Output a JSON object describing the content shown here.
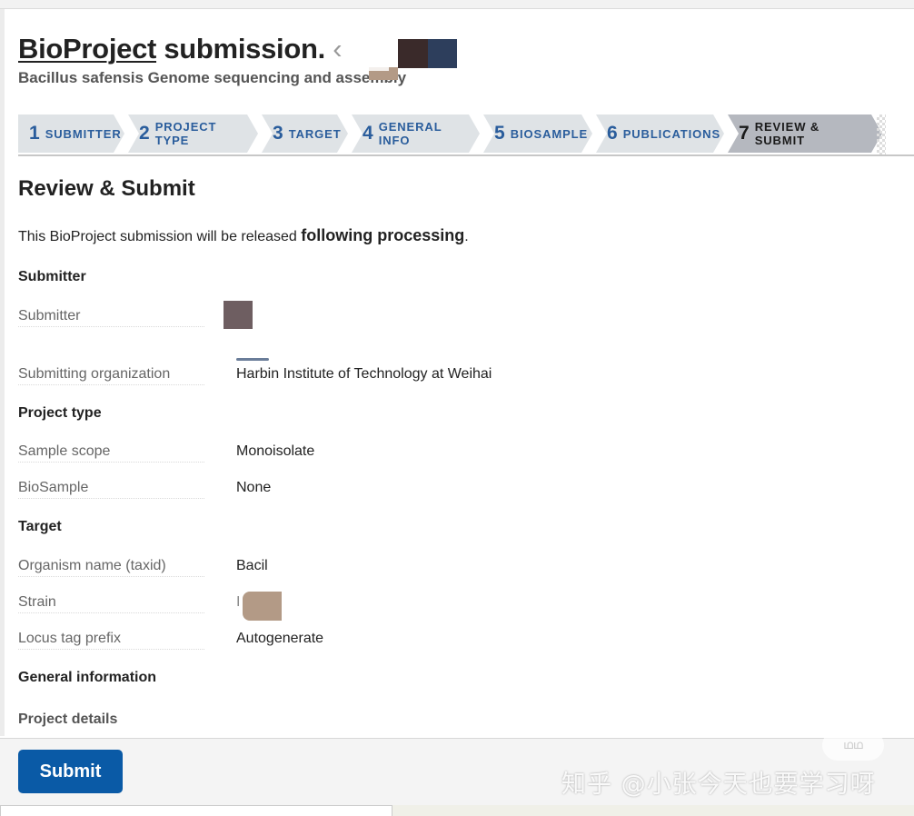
{
  "header": {
    "title_link": "BioProject",
    "title_rest": " submission.",
    "title_trailing": " ‹",
    "subtitle": "Bacillus safensis Genome sequencing and assembly"
  },
  "steps": [
    {
      "num": "1",
      "label": "Submitter"
    },
    {
      "num": "2",
      "label": "Project type"
    },
    {
      "num": "3",
      "label": "Target"
    },
    {
      "num": "4",
      "label": "General info"
    },
    {
      "num": "5",
      "label": "Biosample"
    },
    {
      "num": "6",
      "label": "Publications"
    },
    {
      "num": "7",
      "label": "Review & Submit",
      "active": true
    }
  ],
  "review": {
    "heading": "Review & Submit",
    "release_prefix": "This BioProject submission will be released ",
    "release_bold": "following processing",
    "release_suffix": "."
  },
  "submitter": {
    "title": "Submitter",
    "submitter_label": "Submitter",
    "org_label": "Submitting organization",
    "org_value": "Harbin Institute of Technology at Weihai"
  },
  "project_type": {
    "title": "Project type",
    "scope_label": "Sample scope",
    "scope_value": "Monoisolate",
    "biosample_label": "BioSample",
    "biosample_value": "None"
  },
  "target": {
    "title": "Target",
    "organism_label": "Organism name (taxid)",
    "organism_value": "Bacil",
    "strain_label": "Strain",
    "strain_value": "I",
    "locus_label": "Locus tag prefix",
    "locus_value": "Autogenerate"
  },
  "general": {
    "title": "General information",
    "details_title": "Project details"
  },
  "footer": {
    "submit_label": "Submit",
    "watermark": "知乎 @小张今天也要学习呀",
    "badge": "ഥഥ"
  },
  "colors": {
    "step_text": "#2a5d9c",
    "submit_bg": "#0a5aa6",
    "active_step_bg": "#b5b8bf"
  }
}
